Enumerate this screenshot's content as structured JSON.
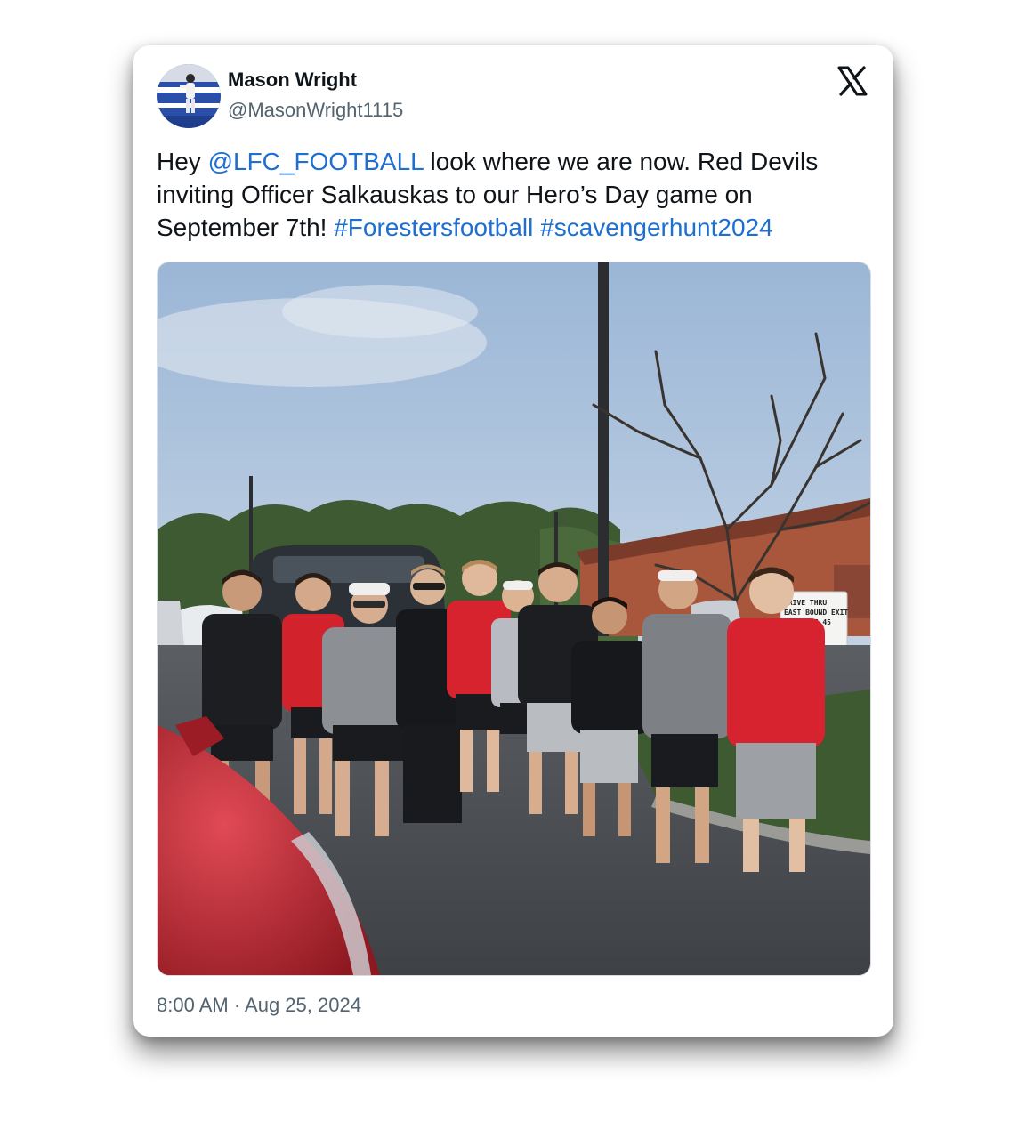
{
  "author": {
    "name": "Mason Wright",
    "handle": "@MasonWright1115"
  },
  "tweet": {
    "text_1": "Hey ",
    "mention": "@LFC_FOOTBALL",
    "text_2": " look where we are now. Red Devils inviting Officer Salkauskas to our Hero’s Day game on September 7th! ",
    "hashtag_1": "#Forestersfootball",
    "text_3": " ",
    "hashtag_2": "#scavengerhunt2024"
  },
  "photo": {
    "sign_line_1": "DRIVE THRU",
    "sign_line_2": "EAST BOUND EXIT",
    "sign_line_3": "TO ROUTE 45"
  },
  "timestamp": "8:00 AM · Aug 25, 2024",
  "icons": {
    "platform": "x-logo-icon",
    "avatar": "avatar"
  },
  "colors": {
    "link": "#1d6fd1",
    "text": "#0f1419",
    "muted": "#536471"
  }
}
